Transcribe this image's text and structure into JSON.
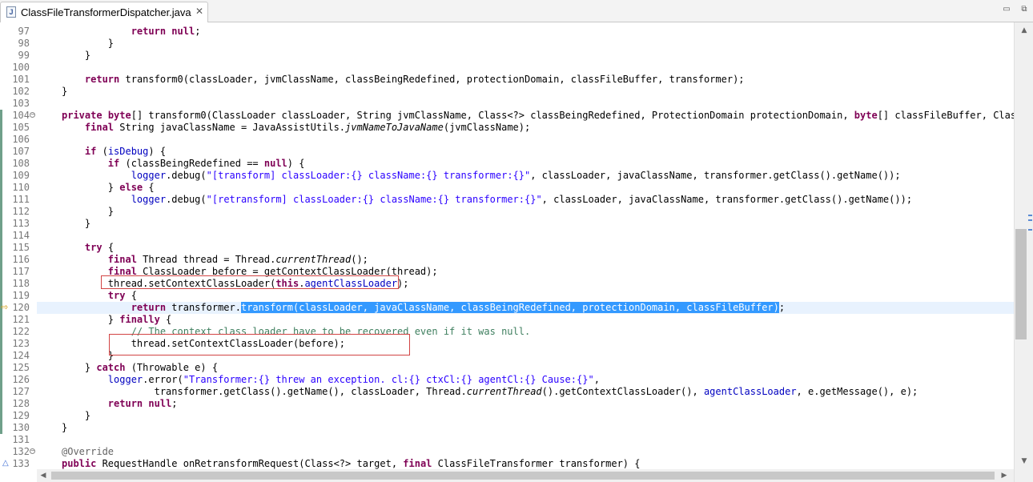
{
  "tab": {
    "icon": "java-file-icon",
    "icon_glyph": "J",
    "title": "ClassFileTransformerDispatcher.java",
    "close_glyph": "✕"
  },
  "window_controls": {
    "minimize": "▭",
    "maximize": "⧉"
  },
  "gutter": [
    {
      "n": "97",
      "changed": false
    },
    {
      "n": "98",
      "changed": false
    },
    {
      "n": "99",
      "changed": false
    },
    {
      "n": "100",
      "changed": false
    },
    {
      "n": "101",
      "changed": false
    },
    {
      "n": "102",
      "changed": false
    },
    {
      "n": "103",
      "changed": false
    },
    {
      "n": "104",
      "changed": true,
      "fold": "−"
    },
    {
      "n": "105",
      "changed": true
    },
    {
      "n": "106",
      "changed": true
    },
    {
      "n": "107",
      "changed": true
    },
    {
      "n": "108",
      "changed": true
    },
    {
      "n": "109",
      "changed": true
    },
    {
      "n": "110",
      "changed": true
    },
    {
      "n": "111",
      "changed": true
    },
    {
      "n": "112",
      "changed": true
    },
    {
      "n": "113",
      "changed": true
    },
    {
      "n": "114",
      "changed": true
    },
    {
      "n": "115",
      "changed": true
    },
    {
      "n": "116",
      "changed": true
    },
    {
      "n": "117",
      "changed": true
    },
    {
      "n": "118",
      "changed": true
    },
    {
      "n": "119",
      "changed": true
    },
    {
      "n": "120",
      "changed": true,
      "marker": "⇨"
    },
    {
      "n": "121",
      "changed": true
    },
    {
      "n": "122",
      "changed": true
    },
    {
      "n": "123",
      "changed": true
    },
    {
      "n": "124",
      "changed": true
    },
    {
      "n": "125",
      "changed": true
    },
    {
      "n": "126",
      "changed": true
    },
    {
      "n": "127",
      "changed": true
    },
    {
      "n": "128",
      "changed": true
    },
    {
      "n": "129",
      "changed": true
    },
    {
      "n": "130",
      "changed": true
    },
    {
      "n": "131",
      "changed": false
    },
    {
      "n": "132",
      "changed": false,
      "fold": "−"
    },
    {
      "n": "133",
      "changed": false,
      "marker": "△"
    }
  ],
  "code": [
    [
      [
        "t",
        "            "
      ],
      [
        "kw",
        "return"
      ],
      [
        "t",
        " "
      ],
      [
        "kw",
        "null"
      ],
      [
        "t",
        ";"
      ]
    ],
    [
      [
        "t",
        "        }"
      ]
    ],
    [
      [
        "t",
        "    }"
      ]
    ],
    [
      [
        "t",
        ""
      ]
    ],
    [
      [
        "t",
        "    "
      ],
      [
        "kw",
        "return"
      ],
      [
        "t",
        " transform0(classLoader, jvmClassName, classBeingRedefined, protectionDomain, classFileBuffer, transformer);"
      ]
    ],
    [
      [
        "t",
        "}"
      ]
    ],
    [
      [
        "t",
        ""
      ]
    ],
    [
      [
        "kw",
        "private"
      ],
      [
        "t",
        " "
      ],
      [
        "kw",
        "byte"
      ],
      [
        "t",
        "[] transform0(ClassLoader classLoader, String jvmClassName, Class<?> classBeingRedefined, ProtectionDomain protectionDomain, "
      ],
      [
        "kw",
        "byte"
      ],
      [
        "t",
        "[] classFileBuffer, ClassFileTransformer transformer)"
      ]
    ],
    [
      [
        "t",
        "    "
      ],
      [
        "kw",
        "final"
      ],
      [
        "t",
        " String javaClassName = JavaAssistUtils."
      ],
      [
        "ital",
        "jvmNameToJavaName"
      ],
      [
        "t",
        "(jvmClassName);"
      ]
    ],
    [
      [
        "t",
        ""
      ]
    ],
    [
      [
        "t",
        "    "
      ],
      [
        "kw",
        "if"
      ],
      [
        "t",
        " ("
      ],
      [
        "fld",
        "isDebug"
      ],
      [
        "t",
        ") {"
      ]
    ],
    [
      [
        "t",
        "        "
      ],
      [
        "kw",
        "if"
      ],
      [
        "t",
        " (classBeingRedefined == "
      ],
      [
        "kw",
        "null"
      ],
      [
        "t",
        ") {"
      ]
    ],
    [
      [
        "t",
        "            "
      ],
      [
        "fld",
        "logger"
      ],
      [
        "t",
        ".debug("
      ],
      [
        "str",
        "\"[transform] classLoader:{} className:{} transformer:{}\""
      ],
      [
        "t",
        ", classLoader, javaClassName, transformer.getClass().getName());"
      ]
    ],
    [
      [
        "t",
        "        } "
      ],
      [
        "kw",
        "else"
      ],
      [
        "t",
        " {"
      ]
    ],
    [
      [
        "t",
        "            "
      ],
      [
        "fld",
        "logger"
      ],
      [
        "t",
        ".debug("
      ],
      [
        "str",
        "\"[retransform] classLoader:{} className:{} transformer:{}\""
      ],
      [
        "t",
        ", classLoader, javaClassName, transformer.getClass().getName());"
      ]
    ],
    [
      [
        "t",
        "        }"
      ]
    ],
    [
      [
        "t",
        "    }"
      ]
    ],
    [
      [
        "t",
        ""
      ]
    ],
    [
      [
        "t",
        "    "
      ],
      [
        "kw",
        "try"
      ],
      [
        "t",
        " {"
      ]
    ],
    [
      [
        "t",
        "        "
      ],
      [
        "kw",
        "final"
      ],
      [
        "t",
        " Thread thread = Thread."
      ],
      [
        "ital",
        "currentThread"
      ],
      [
        "t",
        "();"
      ]
    ],
    [
      [
        "t",
        "        "
      ],
      [
        "kw",
        "final"
      ],
      [
        "t",
        " ClassLoader before = getContextClassLoader(thread);"
      ]
    ],
    [
      [
        "t",
        "        thread.setContextClassLoader("
      ],
      [
        "kw",
        "this"
      ],
      [
        "t",
        "."
      ],
      [
        "fld",
        "agentClassLoader"
      ],
      [
        "t",
        ");"
      ]
    ],
    [
      [
        "t",
        "        "
      ],
      [
        "kw",
        "try"
      ],
      [
        "t",
        " {"
      ]
    ],
    [
      [
        "t",
        "            "
      ],
      [
        "kw",
        "return"
      ],
      [
        "t",
        " transformer."
      ],
      [
        "sel",
        "transform(classLoader, javaClassName, classBeingRedefined, protectionDomain, classFileBuffer)"
      ],
      [
        "t",
        ";"
      ]
    ],
    [
      [
        "t",
        "        } "
      ],
      [
        "kw",
        "finally"
      ],
      [
        "t",
        " {"
      ]
    ],
    [
      [
        "t",
        "            "
      ],
      [
        "cmt",
        "// The context class loader have to be recovered even if it was null."
      ]
    ],
    [
      [
        "t",
        "            thread.setContextClassLoader(before);"
      ]
    ],
    [
      [
        "t",
        "        }"
      ]
    ],
    [
      [
        "t",
        "    } "
      ],
      [
        "kw",
        "catch"
      ],
      [
        "t",
        " (Throwable e) {"
      ]
    ],
    [
      [
        "t",
        "        "
      ],
      [
        "fld",
        "logger"
      ],
      [
        "t",
        ".error("
      ],
      [
        "str",
        "\"Transformer:{} threw an exception. cl:{} ctxCl:{} agentCl:{} Cause:{}\""
      ],
      [
        "t",
        ","
      ]
    ],
    [
      [
        "t",
        "                transformer.getClass().getName(), classLoader, Thread."
      ],
      [
        "ital",
        "currentThread"
      ],
      [
        "t",
        "().getContextClassLoader(), "
      ],
      [
        "fld",
        "agentClassLoader"
      ],
      [
        "t",
        ", e.getMessage(), e);"
      ]
    ],
    [
      [
        "t",
        "        "
      ],
      [
        "kw",
        "return"
      ],
      [
        "t",
        " "
      ],
      [
        "kw",
        "null"
      ],
      [
        "t",
        ";"
      ]
    ],
    [
      [
        "t",
        "    }"
      ]
    ],
    [
      [
        "t",
        "}"
      ]
    ],
    [
      [
        "t",
        ""
      ]
    ],
    [
      [
        "ann",
        "@Override"
      ]
    ],
    [
      [
        "kw",
        "public"
      ],
      [
        "t",
        " RequestHandle onRetransformRequest(Class<?> target, "
      ],
      [
        "kw",
        "final"
      ],
      [
        "t",
        " ClassFileTransformer transformer) {"
      ]
    ]
  ],
  "current_line_index": 23,
  "highlight_boxes": [
    {
      "name": "highlight-box-line-118"
    },
    {
      "name": "highlight-box-line-123"
    }
  ],
  "scroll": {
    "vertical_icon_up": "▲",
    "vertical_icon_down": "▼",
    "horizontal_icon_left": "◀",
    "horizontal_icon_right": "▶"
  }
}
